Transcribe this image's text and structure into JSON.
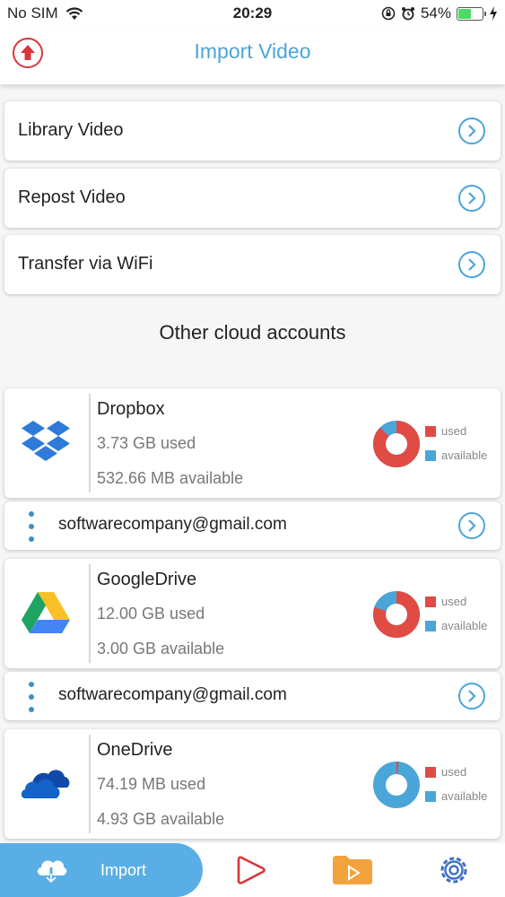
{
  "status_bar": {
    "carrier": "No SIM",
    "time": "20:29",
    "battery_percent": "54%",
    "battery_level": 0.54
  },
  "nav": {
    "title": "Import Video",
    "left_icon": "upload-arrow-icon"
  },
  "menu": {
    "items": [
      {
        "label": "Library Video",
        "icon": "chevron-right-icon"
      },
      {
        "label": "Repost Video",
        "icon": "chevron-right-icon"
      },
      {
        "label": "Transfer via WiFi",
        "icon": "chevron-right-icon"
      }
    ]
  },
  "section": {
    "title": "Other cloud accounts"
  },
  "legend": {
    "used": "used",
    "available": "available"
  },
  "accounts": [
    {
      "name": "Dropbox",
      "used": "3.73 GB used",
      "available": "532.66 MB available",
      "email": "softwarecompany@gmail.com",
      "used_fraction": 0.875,
      "icon": "dropbox-icon"
    },
    {
      "name": "GoogleDrive",
      "used": "12.00 GB used",
      "available": "3.00 GB available",
      "email": "softwarecompany@gmail.com",
      "used_fraction": 0.8,
      "icon": "google-drive-icon"
    },
    {
      "name": "OneDrive",
      "used": "74.19 MB used",
      "available": "4.93 GB available",
      "used_fraction": 0.015,
      "icon": "onedrive-icon"
    }
  ],
  "tab_bar": {
    "import_label": "Import",
    "tabs": [
      "import-icon",
      "play-icon",
      "folder-icon",
      "settings-icon"
    ]
  },
  "colors": {
    "accent": "#4aa5d8",
    "used": "#e04b44",
    "available": "#4aa5d8",
    "tab_active": "#5aaee6",
    "upload_red": "#d9353c",
    "folder": "#f2a33c"
  }
}
